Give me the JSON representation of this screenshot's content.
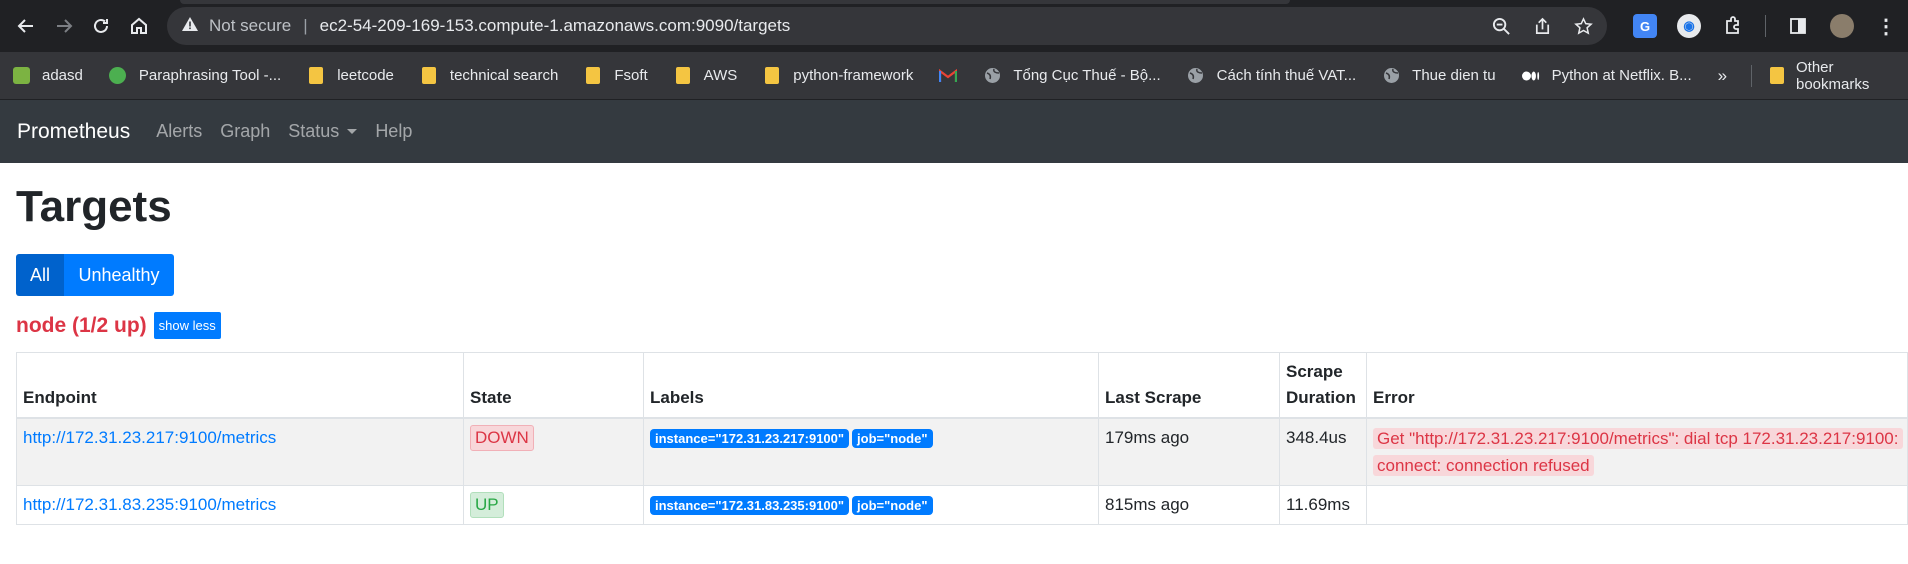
{
  "browser": {
    "not_secure": "Not secure",
    "url": "ec2-54-209-169-153.compute-1.amazonaws.com:9090/targets"
  },
  "bookmarks": [
    {
      "label": "adasd",
      "icon": "app-icon"
    },
    {
      "label": "Paraphrasing Tool -...",
      "icon": "paraphrase-icon"
    },
    {
      "label": "leetcode",
      "icon": "folder-icon"
    },
    {
      "label": "technical search",
      "icon": "folder-icon"
    },
    {
      "label": "Fsoft",
      "icon": "folder-icon"
    },
    {
      "label": "AWS",
      "icon": "folder-icon"
    },
    {
      "label": "python-framework",
      "icon": "folder-icon"
    },
    {
      "label": "",
      "icon": "gmail-icon"
    },
    {
      "label": "Tổng Cục Thuế - Bộ...",
      "icon": "globe-icon"
    },
    {
      "label": "Cách tính thuế VAT...",
      "icon": "globe-icon"
    },
    {
      "label": "Thue dien tu",
      "icon": "globe-icon"
    },
    {
      "label": "Python at Netflix. B...",
      "icon": "medium-icon"
    }
  ],
  "bookmarks_more": "»",
  "other_bookmarks": "Other bookmarks",
  "navbar": {
    "brand": "Prometheus",
    "links": [
      "Alerts",
      "Graph",
      "Status",
      "Help"
    ]
  },
  "page": {
    "title": "Targets",
    "filter_all": "All",
    "filter_unhealthy": "Unhealthy"
  },
  "group": {
    "title": "node (1/2 up)",
    "toggle": "show less"
  },
  "table": {
    "headers": {
      "endpoint": "Endpoint",
      "state": "State",
      "labels": "Labels",
      "last_scrape": "Last Scrape",
      "scrape_duration_1": "Scrape",
      "scrape_duration_2": "Duration",
      "error": "Error"
    },
    "rows": [
      {
        "endpoint": "http://172.31.23.217:9100/metrics",
        "state": "DOWN",
        "label_instance": "instance=\"172.31.23.217:9100\"",
        "label_job": "job=\"node\"",
        "last_scrape": "179ms ago",
        "duration": "348.4us",
        "error": "Get \"http://172.31.23.217:9100/metrics\": dial tcp 172.31.23.217:9100: connect: connection refused"
      },
      {
        "endpoint": "http://172.31.83.235:9100/metrics",
        "state": "UP",
        "label_instance": "instance=\"172.31.83.235:9100\"",
        "label_job": "job=\"node\"",
        "last_scrape": "815ms ago",
        "duration": "11.69ms",
        "error": ""
      }
    ]
  },
  "colors": {
    "navbar": "#343a40",
    "primary": "#007bff",
    "danger": "#dc3545",
    "success": "#28a745"
  }
}
